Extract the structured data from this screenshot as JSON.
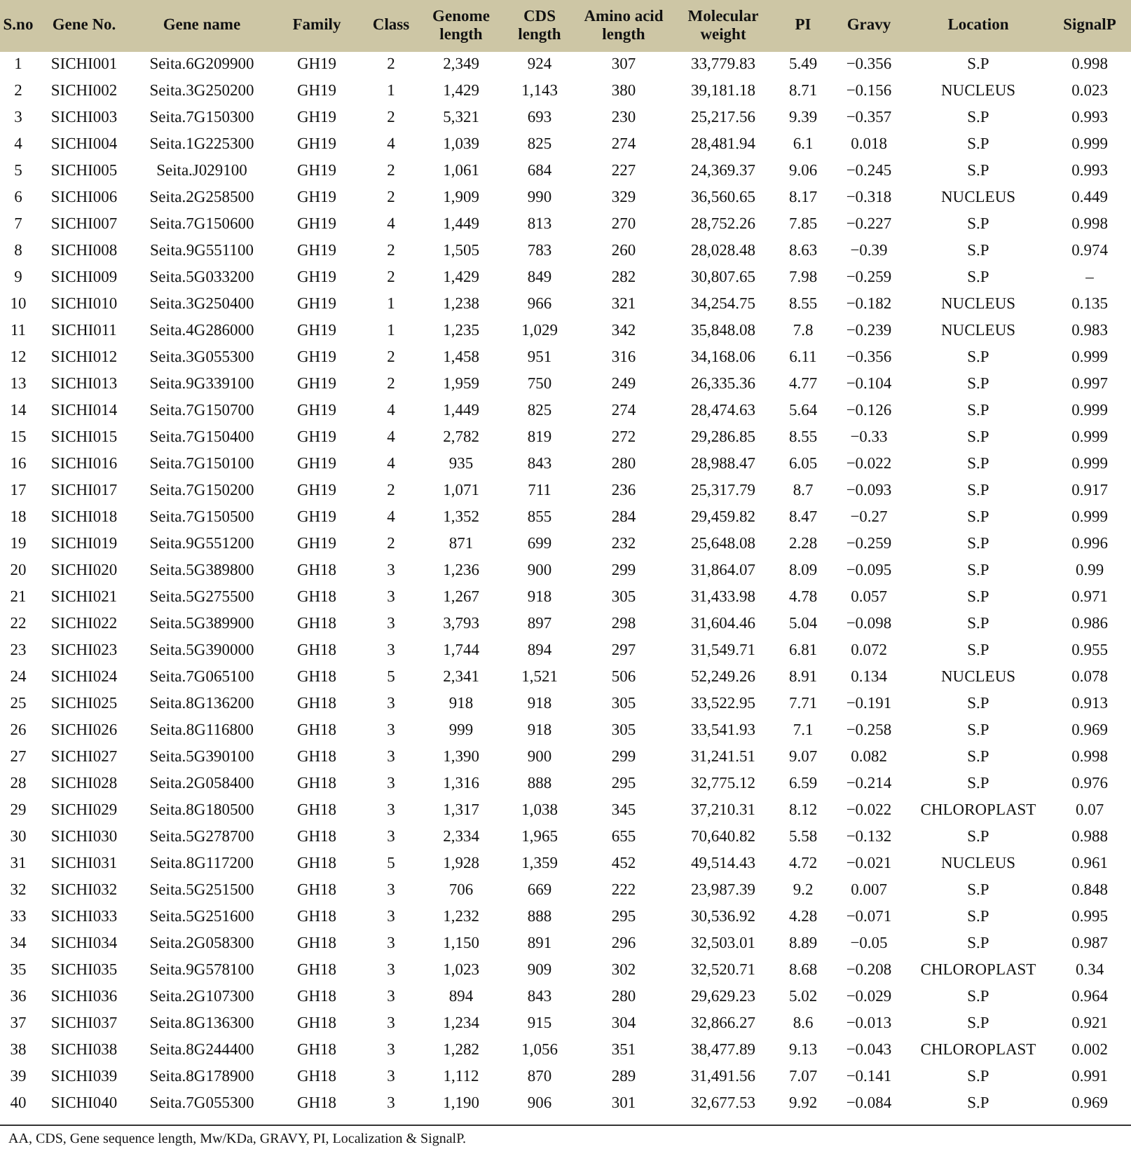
{
  "table": {
    "columns": [
      "S.no",
      "Gene No.",
      "Gene name",
      "Family",
      "Class",
      "Genome length",
      "CDS length",
      "Amino acid length",
      "Molecular weight",
      "PI",
      "Gravy",
      "Location",
      "SignalP"
    ],
    "rows": [
      [
        "1",
        "SICHI001",
        "Seita.6G209900",
        "GH19",
        "2",
        "2,349",
        "924",
        "307",
        "33,779.83",
        "5.49",
        "−0.356",
        "S.P",
        "0.998"
      ],
      [
        "2",
        "SICHI002",
        "Seita.3G250200",
        "GH19",
        "1",
        "1,429",
        "1,143",
        "380",
        "39,181.18",
        "8.71",
        "−0.156",
        "NUCLEUS",
        "0.023"
      ],
      [
        "3",
        "SICHI003",
        "Seita.7G150300",
        "GH19",
        "2",
        "5,321",
        "693",
        "230",
        "25,217.56",
        "9.39",
        "−0.357",
        "S.P",
        "0.993"
      ],
      [
        "4",
        "SICHI004",
        "Seita.1G225300",
        "GH19",
        "4",
        "1,039",
        "825",
        "274",
        "28,481.94",
        "6.1",
        "0.018",
        "S.P",
        "0.999"
      ],
      [
        "5",
        "SICHI005",
        "Seita.J029100",
        "GH19",
        "2",
        "1,061",
        "684",
        "227",
        "24,369.37",
        "9.06",
        "−0.245",
        "S.P",
        "0.993"
      ],
      [
        "6",
        "SICHI006",
        "Seita.2G258500",
        "GH19",
        "2",
        "1,909",
        "990",
        "329",
        "36,560.65",
        "8.17",
        "−0.318",
        "NUCLEUS",
        "0.449"
      ],
      [
        "7",
        "SICHI007",
        "Seita.7G150600",
        "GH19",
        "4",
        "1,449",
        "813",
        "270",
        "28,752.26",
        "7.85",
        "−0.227",
        "S.P",
        "0.998"
      ],
      [
        "8",
        "SICHI008",
        "Seita.9G551100",
        "GH19",
        "2",
        "1,505",
        "783",
        "260",
        "28,028.48",
        "8.63",
        "−0.39",
        "S.P",
        "0.974"
      ],
      [
        "9",
        "SICHI009",
        "Seita.5G033200",
        "GH19",
        "2",
        "1,429",
        "849",
        "282",
        "30,807.65",
        "7.98",
        "−0.259",
        "S.P",
        "–"
      ],
      [
        "10",
        "SICHI010",
        "Seita.3G250400",
        "GH19",
        "1",
        "1,238",
        "966",
        "321",
        "34,254.75",
        "8.55",
        "−0.182",
        "NUCLEUS",
        "0.135"
      ],
      [
        "11",
        "SICHI011",
        "Seita.4G286000",
        "GH19",
        "1",
        "1,235",
        "1,029",
        "342",
        "35,848.08",
        "7.8",
        "−0.239",
        "NUCLEUS",
        "0.983"
      ],
      [
        "12",
        "SICHI012",
        "Seita.3G055300",
        "GH19",
        "2",
        "1,458",
        "951",
        "316",
        "34,168.06",
        "6.11",
        "−0.356",
        "S.P",
        "0.999"
      ],
      [
        "13",
        "SICHI013",
        "Seita.9G339100",
        "GH19",
        "2",
        "1,959",
        "750",
        "249",
        "26,335.36",
        "4.77",
        "−0.104",
        "S.P",
        "0.997"
      ],
      [
        "14",
        "SICHI014",
        "Seita.7G150700",
        "GH19",
        "4",
        "1,449",
        "825",
        "274",
        "28,474.63",
        "5.64",
        "−0.126",
        "S.P",
        "0.999"
      ],
      [
        "15",
        "SICHI015",
        "Seita.7G150400",
        "GH19",
        "4",
        "2,782",
        "819",
        "272",
        "29,286.85",
        "8.55",
        "−0.33",
        "S.P",
        "0.999"
      ],
      [
        "16",
        "SICHI016",
        "Seita.7G150100",
        "GH19",
        "4",
        "935",
        "843",
        "280",
        "28,988.47",
        "6.05",
        "−0.022",
        "S.P",
        "0.999"
      ],
      [
        "17",
        "SICHI017",
        "Seita.7G150200",
        "GH19",
        "2",
        "1,071",
        "711",
        "236",
        "25,317.79",
        "8.7",
        "−0.093",
        "S.P",
        "0.917"
      ],
      [
        "18",
        "SICHI018",
        "Seita.7G150500",
        "GH19",
        "4",
        "1,352",
        "855",
        "284",
        "29,459.82",
        "8.47",
        "−0.27",
        "S.P",
        "0.999"
      ],
      [
        "19",
        "SICHI019",
        "Seita.9G551200",
        "GH19",
        "2",
        "871",
        "699",
        "232",
        "25,648.08",
        "2.28",
        "−0.259",
        "S.P",
        "0.996"
      ],
      [
        "20",
        "SICHI020",
        "Seita.5G389800",
        "GH18",
        "3",
        "1,236",
        "900",
        "299",
        "31,864.07",
        "8.09",
        "−0.095",
        "S.P",
        "0.99"
      ],
      [
        "21",
        "SICHI021",
        "Seita.5G275500",
        "GH18",
        "3",
        "1,267",
        "918",
        "305",
        "31,433.98",
        "4.78",
        "0.057",
        "S.P",
        "0.971"
      ],
      [
        "22",
        "SICHI022",
        "Seita.5G389900",
        "GH18",
        "3",
        "3,793",
        "897",
        "298",
        "31,604.46",
        "5.04",
        "−0.098",
        "S.P",
        "0.986"
      ],
      [
        "23",
        "SICHI023",
        "Seita.5G390000",
        "GH18",
        "3",
        "1,744",
        "894",
        "297",
        "31,549.71",
        "6.81",
        "0.072",
        "S.P",
        "0.955"
      ],
      [
        "24",
        "SICHI024",
        "Seita.7G065100",
        "GH18",
        "5",
        "2,341",
        "1,521",
        "506",
        "52,249.26",
        "8.91",
        "0.134",
        "NUCLEUS",
        "0.078"
      ],
      [
        "25",
        "SICHI025",
        "Seita.8G136200",
        "GH18",
        "3",
        "918",
        "918",
        "305",
        "33,522.95",
        "7.71",
        "−0.191",
        "S.P",
        "0.913"
      ],
      [
        "26",
        "SICHI026",
        "Seita.8G116800",
        "GH18",
        "3",
        "999",
        "918",
        "305",
        "33,541.93",
        "7.1",
        "−0.258",
        "S.P",
        "0.969"
      ],
      [
        "27",
        "SICHI027",
        "Seita.5G390100",
        "GH18",
        "3",
        "1,390",
        "900",
        "299",
        "31,241.51",
        "9.07",
        "0.082",
        "S.P",
        "0.998"
      ],
      [
        "28",
        "SICHI028",
        "Seita.2G058400",
        "GH18",
        "3",
        "1,316",
        "888",
        "295",
        "32,775.12",
        "6.59",
        "−0.214",
        "S.P",
        "0.976"
      ],
      [
        "29",
        "SICHI029",
        "Seita.8G180500",
        "GH18",
        "3",
        "1,317",
        "1,038",
        "345",
        "37,210.31",
        "8.12",
        "−0.022",
        "CHLOROPLAST",
        "0.07"
      ],
      [
        "30",
        "SICHI030",
        "Seita.5G278700",
        "GH18",
        "3",
        "2,334",
        "1,965",
        "655",
        "70,640.82",
        "5.58",
        "−0.132",
        "S.P",
        "0.988"
      ],
      [
        "31",
        "SICHI031",
        "Seita.8G117200",
        "GH18",
        "5",
        "1,928",
        "1,359",
        "452",
        "49,514.43",
        "4.72",
        "−0.021",
        "NUCLEUS",
        "0.961"
      ],
      [
        "32",
        "SICHI032",
        "Seita.5G251500",
        "GH18",
        "3",
        "706",
        "669",
        "222",
        "23,987.39",
        "9.2",
        "0.007",
        "S.P",
        "0.848"
      ],
      [
        "33",
        "SICHI033",
        "Seita.5G251600",
        "GH18",
        "3",
        "1,232",
        "888",
        "295",
        "30,536.92",
        "4.28",
        "−0.071",
        "S.P",
        "0.995"
      ],
      [
        "34",
        "SICHI034",
        "Seita.2G058300",
        "GH18",
        "3",
        "1,150",
        "891",
        "296",
        "32,503.01",
        "8.89",
        "−0.05",
        "S.P",
        "0.987"
      ],
      [
        "35",
        "SICHI035",
        "Seita.9G578100",
        "GH18",
        "3",
        "1,023",
        "909",
        "302",
        "32,520.71",
        "8.68",
        "−0.208",
        "CHLOROPLAST",
        "0.34"
      ],
      [
        "36",
        "SICHI036",
        "Seita.2G107300",
        "GH18",
        "3",
        "894",
        "843",
        "280",
        "29,629.23",
        "5.02",
        "−0.029",
        "S.P",
        "0.964"
      ],
      [
        "37",
        "SICHI037",
        "Seita.8G136300",
        "GH18",
        "3",
        "1,234",
        "915",
        "304",
        "32,866.27",
        "8.6",
        "−0.013",
        "S.P",
        "0.921"
      ],
      [
        "38",
        "SICHI038",
        "Seita.8G244400",
        "GH18",
        "3",
        "1,282",
        "1,056",
        "351",
        "38,477.89",
        "9.13",
        "−0.043",
        "CHLOROPLAST",
        "0.002"
      ],
      [
        "39",
        "SICHI039",
        "Seita.8G178900",
        "GH18",
        "3",
        "1,112",
        "870",
        "289",
        "31,491.56",
        "7.07",
        "−0.141",
        "S.P",
        "0.991"
      ],
      [
        "40",
        "SICHI040",
        "Seita.7G055300",
        "GH18",
        "3",
        "1,190",
        "906",
        "301",
        "32,677.53",
        "9.92",
        "−0.084",
        "S.P",
        "0.969"
      ]
    ],
    "footnote": "AA, CDS, Gene sequence length, Mw/KDa, GRAVY, PI, Localization & SignalP."
  }
}
